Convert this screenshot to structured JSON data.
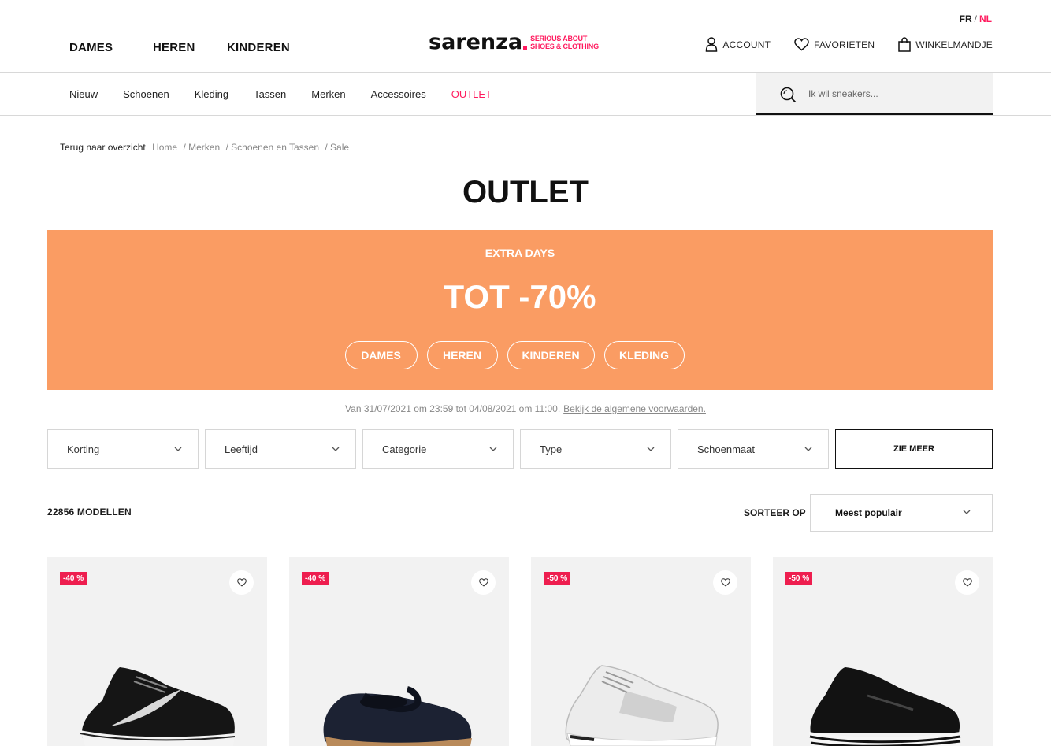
{
  "header": {
    "lang": {
      "fr": "FR",
      "sep": "/",
      "nl": "NL"
    },
    "main_nav": [
      "DAMES",
      "HEREN",
      "KINDEREN"
    ],
    "logo": {
      "word": "sarenza",
      "tag_line1": "SERIOUS ABOUT",
      "tag_line2": "SHOES & CLOTHING"
    },
    "user_nav": {
      "account": "ACCOUNT",
      "favorites": "FAVORIETEN",
      "cart": "WINKELMANDJE"
    }
  },
  "sub_nav": [
    "Nieuw",
    "Schoenen",
    "Kleding",
    "Tassen",
    "Merken",
    "Accessoires",
    "OUTLET"
  ],
  "search": {
    "placeholder": "Ik wil sneakers..."
  },
  "breadcrumb": {
    "back": "Terug naar overzicht",
    "items": [
      "Home",
      "/ Merken",
      "/ Schoenen en Tassen",
      "/ Sale"
    ]
  },
  "page_title": "OUTLET",
  "banner": {
    "eyebrow": "EXTRA DAYS",
    "headline": "TOT -70%",
    "buttons": [
      "DAMES",
      "HEREN",
      "KINDEREN",
      "KLEDING"
    ],
    "color": "#fa9c63"
  },
  "validity": {
    "text": "Van 31/07/2021 om 23:59 tot 04/08/2021 om 11:00.",
    "link": "Bekijk de algemene voorwaarden."
  },
  "filters": [
    "Korting",
    "Leeftijd",
    "Categorie",
    "Type",
    "Schoenmaat"
  ],
  "see_more": "ZIE MEER",
  "results": {
    "count": "22856 MODELLEN",
    "sort_label": "SORTEER OP",
    "sort_value": "Meest populair"
  },
  "products": [
    {
      "badge": "-40 %"
    },
    {
      "badge": "-40 %"
    },
    {
      "badge": "-50 %"
    },
    {
      "badge": "-50 %"
    }
  ],
  "colors": {
    "brand_pink": "#ff1a5e",
    "badge": "#ee1e4f"
  }
}
